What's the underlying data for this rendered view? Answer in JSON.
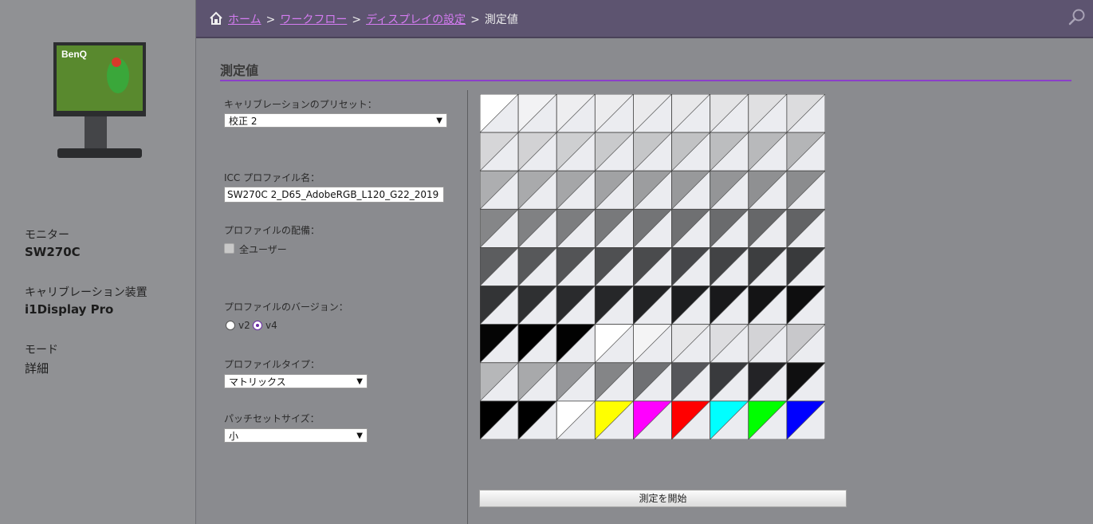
{
  "sidebar": {
    "monitor_brand": "BenQ",
    "monitor_label": "モニター",
    "monitor_value": "SW270C",
    "device_label": "キャリブレーション装置",
    "device_value": "i1Display Pro",
    "mode_label": "モード",
    "mode_value": "詳細"
  },
  "breadcrumb": {
    "home": "ホーム",
    "workflow": "ワークフロー",
    "display_settings": "ディスプレイの設定",
    "current": "測定値",
    "separator": ">"
  },
  "page_title": "測定値",
  "form": {
    "preset_label": "キャリブレーションのプリセット：",
    "preset_value": "校正 2",
    "icc_label": "ICC プロファイル名：",
    "icc_value": "SW270C 2_D65_AdobeRGB_L120_G22_2019",
    "distribution_label": "プロファイルの配備：",
    "all_users_label": "全ユーザー",
    "all_users_checked": false,
    "version_label": "プロファイルのバージョン：",
    "version_v2": "v2",
    "version_v4": "v4",
    "version_selected": "v4",
    "type_label": "プロファイルタイプ：",
    "type_value": "マトリックス",
    "patch_label": "パッチセットサイズ：",
    "patch_value": "小"
  },
  "start_button": "測定を開始",
  "colors": {
    "accent": "#8b3fc9",
    "link": "#d57cf2",
    "header": "#5d5470"
  },
  "patches": [
    [
      "#ffffff",
      "#f2f2f4",
      "#eeeef0",
      "#ececee",
      "#eaeaec",
      "#e8e8ea",
      "#e4e4e6",
      "#e0e0e2",
      "#dcdcde"
    ],
    [
      "#d6d6d8",
      "#d2d2d4",
      "#cecfd1",
      "#c9cacc",
      "#c5c6c8",
      "#c1c2c4",
      "#bcbdbf",
      "#b8b9bb",
      "#b4b5b7"
    ],
    [
      "#adaeb0",
      "#a9aaac",
      "#a5a6a8",
      "#a1a2a4",
      "#9c9d9f",
      "#98999b",
      "#949597",
      "#8f9092",
      "#8b8c8e"
    ],
    [
      "#858688",
      "#808183",
      "#7c7d7f",
      "#78797b",
      "#737476",
      "#6f7072",
      "#6a6b6d",
      "#666769",
      "#626365"
    ],
    [
      "#5c5d5f",
      "#57585a",
      "#535456",
      "#4f5052",
      "#4a4b4d",
      "#46474a",
      "#424345",
      "#3d3e40",
      "#393a3c"
    ],
    [
      "#333436",
      "#2f3032",
      "#2a2b2d",
      "#262729",
      "#222325",
      "#1d1e20",
      "#19191b",
      "#141415",
      "#0e0e0f"
    ],
    [
      "#050505",
      "#000000",
      "#020202",
      "#ffffff",
      "#f4f4f5",
      "#e6e6e8",
      "#dddde0",
      "#d3d3d6",
      "#c8c8cb"
    ],
    [
      "#b6b7b9",
      "#a8a9ab",
      "#96979a",
      "#848587",
      "#6f7073",
      "#55565a",
      "#393a3d",
      "#232326",
      "#0f0f10"
    ],
    [
      "#000000",
      "#000000",
      "#ffffff",
      "#ffff00",
      "#ff00ff",
      "#ff0000",
      "#00ffff",
      "#00ff00",
      "#0000ff"
    ]
  ]
}
